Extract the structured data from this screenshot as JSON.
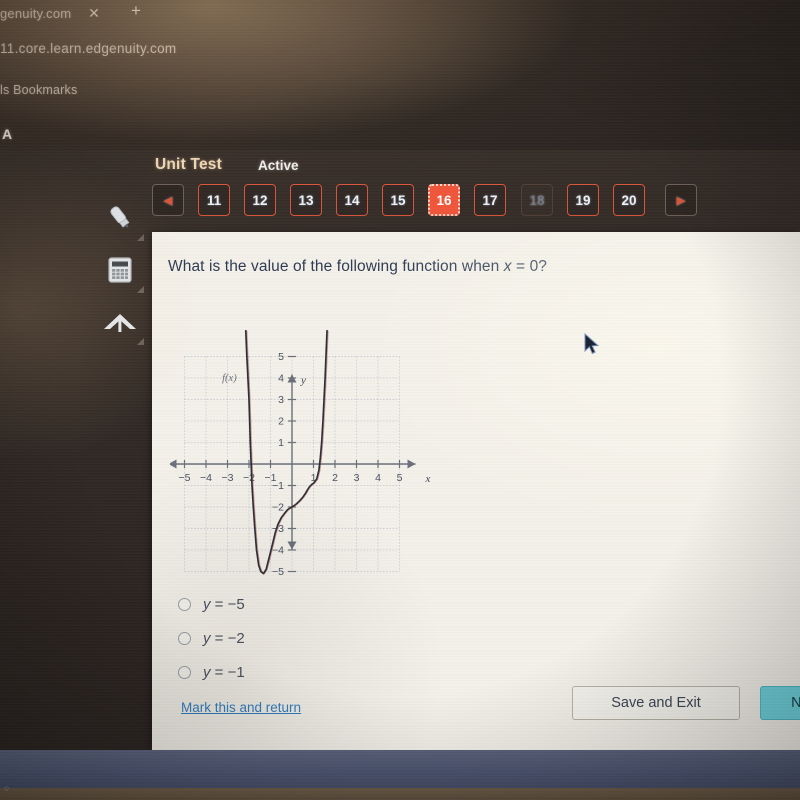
{
  "browser": {
    "tab_title": "genuity.com",
    "close_icon": "close-icon",
    "new_tab_icon": "plus-icon",
    "url": "11.core.learn.edgenuity.com",
    "bookmarks_label": "ls Bookmarks",
    "bookmark_a": "A"
  },
  "app": {
    "assessment_title": "Unit Test",
    "status": "Active",
    "prev_arrow": "◀",
    "next_arrow": "▶",
    "question_numbers": [
      "11",
      "12",
      "13",
      "14",
      "15",
      "16",
      "17",
      "18",
      "19",
      "20"
    ],
    "current_question": "16",
    "dim_question": "18",
    "accent_color": "#f0563a",
    "tools": [
      {
        "name": "highlighter-tool",
        "icon": "highlighter-icon"
      },
      {
        "name": "calculator-tool",
        "icon": "calculator-icon"
      },
      {
        "name": "collapse-tool",
        "icon": "up-arrow-icon"
      }
    ]
  },
  "question": {
    "prompt_before": "What is the value of the following function when ",
    "prompt_var": "x",
    "prompt_after": " = 0?",
    "options": [
      {
        "prefix": "y",
        "rest": " = −5",
        "selected": false
      },
      {
        "prefix": "y",
        "rest": " = −2",
        "selected": false
      },
      {
        "prefix": "y",
        "rest": " = −1",
        "selected": false
      }
    ]
  },
  "footer": {
    "mark_link": "Mark this and return",
    "save_exit": "Save and Exit",
    "next_button": "Next",
    "next_color": "#6fd3dd"
  },
  "chart_data": {
    "type": "line",
    "title": "",
    "xlabel": "x",
    "ylabel": "y",
    "series_label": "f(x)",
    "grid": true,
    "legend": "inline-label",
    "xlim": [
      -5,
      5
    ],
    "ylim": [
      -5,
      5
    ],
    "xticks": [
      -5,
      -4,
      -3,
      -2,
      -1,
      1,
      2,
      3,
      4,
      5
    ],
    "yticks": [
      -5,
      -4,
      -3,
      -2,
      -1,
      1,
      2,
      3,
      4,
      5
    ],
    "xtick_labels": [
      "−5",
      "−4",
      "−3",
      "−2",
      "−1",
      "1",
      "2",
      "3",
      "4",
      "5"
    ],
    "ytick_labels": [
      "−5",
      "−4",
      "−3",
      "−2",
      "−1",
      "1",
      "2",
      "3",
      "4",
      "5"
    ],
    "value_at_x0": -2,
    "points": [
      [
        -2.15,
        6.2
      ],
      [
        -2.1,
        5.0
      ],
      [
        -2.05,
        4.0
      ],
      [
        -2.0,
        3.0
      ],
      [
        -1.97,
        2.0
      ],
      [
        -1.94,
        1.0
      ],
      [
        -1.9,
        0.0
      ],
      [
        -1.86,
        -1.0
      ],
      [
        -1.8,
        -2.0
      ],
      [
        -1.73,
        -3.0
      ],
      [
        -1.65,
        -4.0
      ],
      [
        -1.55,
        -4.7
      ],
      [
        -1.45,
        -5.0
      ],
      [
        -1.33,
        -5.1
      ],
      [
        -1.2,
        -4.9
      ],
      [
        -1.1,
        -4.5
      ],
      [
        -1.0,
        -4.1
      ],
      [
        -0.9,
        -3.7
      ],
      [
        -0.78,
        -3.2
      ],
      [
        -0.65,
        -2.8
      ],
      [
        -0.5,
        -2.5
      ],
      [
        -0.35,
        -2.3
      ],
      [
        -0.2,
        -2.12
      ],
      [
        0.0,
        -2.0
      ],
      [
        0.18,
        -1.88
      ],
      [
        0.35,
        -1.72
      ],
      [
        0.5,
        -1.55
      ],
      [
        0.62,
        -1.38
      ],
      [
        0.72,
        -1.2
      ],
      [
        0.82,
        -1.05
      ],
      [
        0.92,
        -0.95
      ],
      [
        1.02,
        -0.88
      ],
      [
        1.15,
        -0.7
      ],
      [
        1.25,
        -0.3
      ],
      [
        1.32,
        0.3
      ],
      [
        1.38,
        1.0
      ],
      [
        1.44,
        2.0
      ],
      [
        1.49,
        3.0
      ],
      [
        1.54,
        4.0
      ],
      [
        1.58,
        5.0
      ],
      [
        1.63,
        6.2
      ]
    ]
  }
}
